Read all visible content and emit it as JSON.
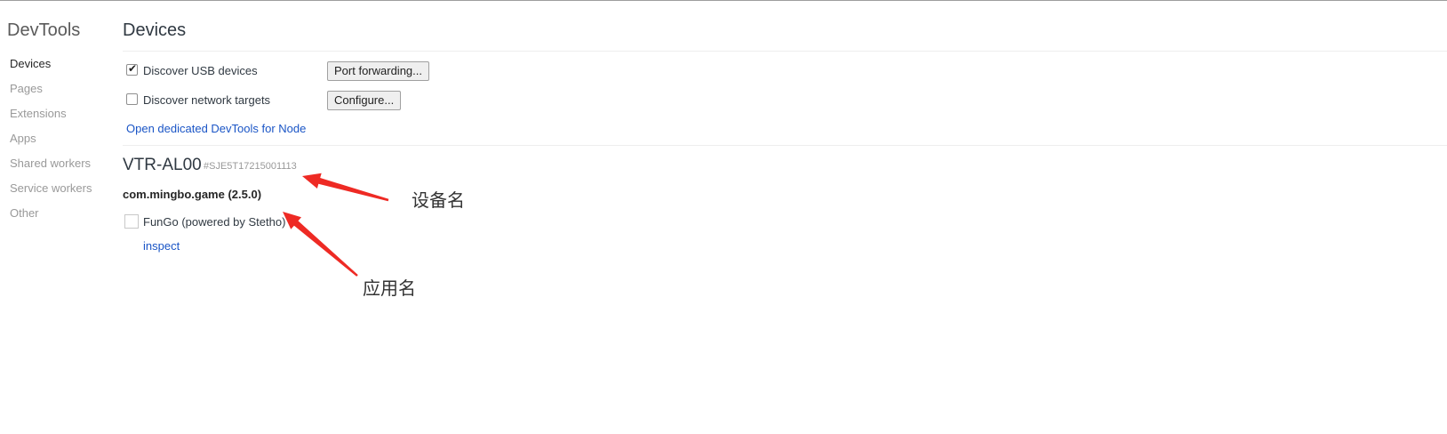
{
  "sidebar": {
    "title": "DevTools",
    "items": [
      {
        "label": "Devices"
      },
      {
        "label": "Pages"
      },
      {
        "label": "Extensions"
      },
      {
        "label": "Apps"
      },
      {
        "label": "Shared workers"
      },
      {
        "label": "Service workers"
      },
      {
        "label": "Other"
      }
    ]
  },
  "main": {
    "title": "Devices",
    "options": {
      "usb": {
        "label": "Discover USB devices",
        "checked": true,
        "button": "Port forwarding..."
      },
      "network": {
        "label": "Discover network targets",
        "checked": false,
        "button": "Configure..."
      }
    },
    "node_link": "Open dedicated DevTools for Node",
    "device": {
      "name": "VTR-AL00",
      "serial": "#SJE5T17215001113",
      "app": "com.mingbo.game (2.5.0)",
      "target": {
        "label": "FunGo (powered by Stetho)",
        "action": "inspect"
      }
    }
  },
  "annotations": {
    "device_label": "设备名",
    "app_label": "应用名",
    "arrow_color": "#ee2a24"
  },
  "colors": {
    "link": "#1a55c6",
    "sidebar_inactive": "#999999",
    "sidebar_active": "#262626"
  }
}
